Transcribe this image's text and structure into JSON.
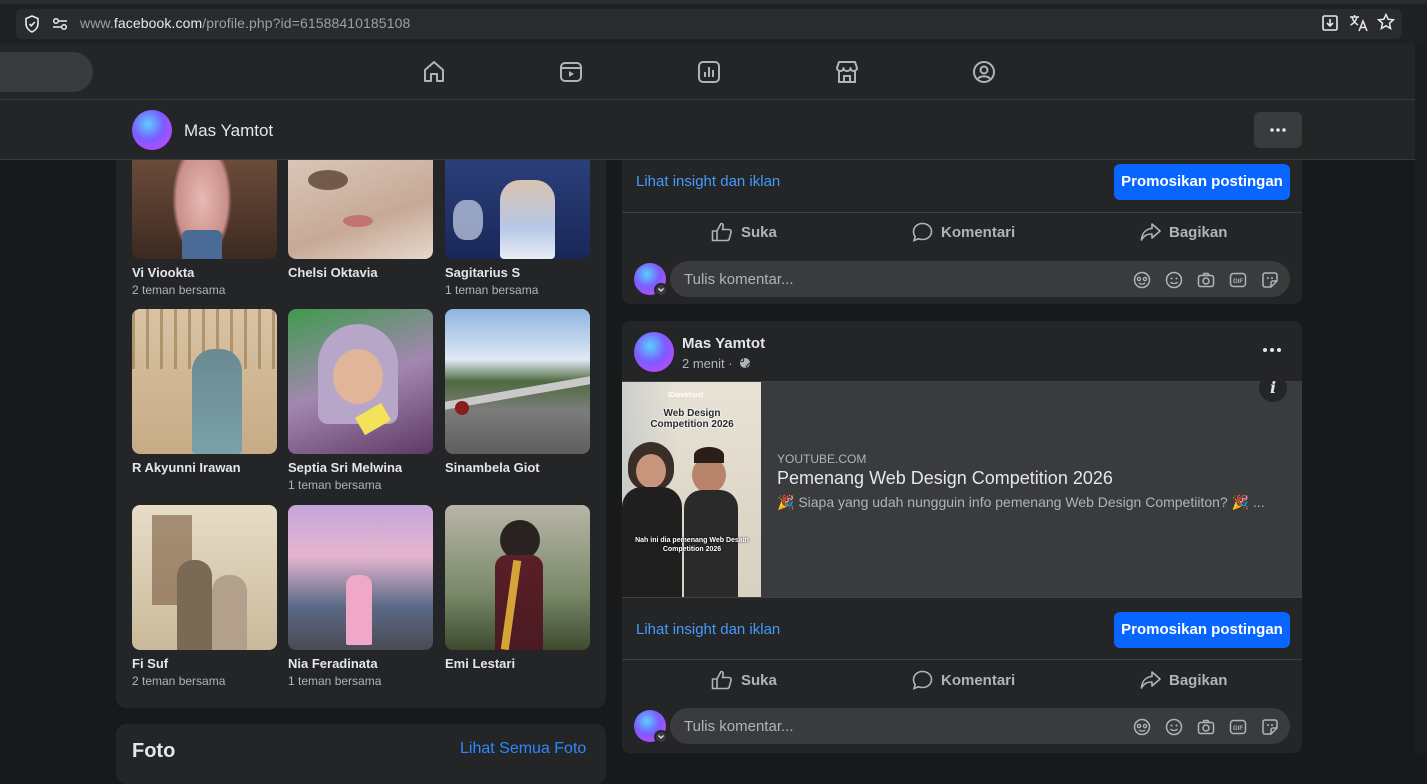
{
  "browser": {
    "url_prefix": "www.",
    "url_domain": "facebook.com",
    "url_path": "/profile.php?id=61588410185108"
  },
  "nav": {
    "icons": [
      "home-icon",
      "video-icon",
      "insights-icon",
      "marketplace-icon",
      "profile-icon"
    ]
  },
  "profile_header": {
    "name": "Mas Yamtot"
  },
  "friends": [
    {
      "name": "Vi Viookta",
      "mutual": "2 teman bersama"
    },
    {
      "name": "Chelsi Oktavia",
      "mutual": ""
    },
    {
      "name": "Sagitarius S",
      "mutual": "1 teman bersama"
    },
    {
      "name": "R Akyunni Irawan",
      "mutual": ""
    },
    {
      "name": "Septia Sri Melwina",
      "mutual": "1 teman bersama"
    },
    {
      "name": "Sinambela Giot",
      "mutual": ""
    },
    {
      "name": "Fi Suf",
      "mutual": "2 teman bersama"
    },
    {
      "name": "Nia Feradinata",
      "mutual": "1 teman bersama"
    },
    {
      "name": "Emi Lestari",
      "mutual": ""
    }
  ],
  "photos": {
    "title": "Foto",
    "see_all": "Lihat Semua Foto"
  },
  "post1": {
    "insight_label": "Lihat insight dan iklan",
    "promote_label": "Promosikan postingan",
    "like_label": "Suka",
    "comment_label": "Komentari",
    "share_label": "Bagikan",
    "comment_placeholder": "Tulis komentar..."
  },
  "post2": {
    "author": "Mas Yamtot",
    "time": "2 menit ·",
    "link": {
      "source": "YOUTUBE.COM",
      "title": "Pemenang Web Design Competition 2026",
      "description": "🎉 Siapa yang udah nungguin info pemenang Web Design Competiiton? 🎉 ...",
      "thumb_brand": "IDwebhost",
      "thumb_headline": "Web Design Competition 2026",
      "thumb_caption": "Nah ini dia pemenang Web Desain Competition 2026"
    },
    "insight_label": "Lihat insight dan iklan",
    "promote_label": "Promosikan postingan",
    "like_label": "Suka",
    "comment_label": "Komentari",
    "share_label": "Bagikan",
    "comment_placeholder": "Tulis komentar..."
  },
  "colors": {
    "accent": "#0866ff",
    "link": "#4599ff",
    "surface": "#242526",
    "background": "#18191a"
  }
}
